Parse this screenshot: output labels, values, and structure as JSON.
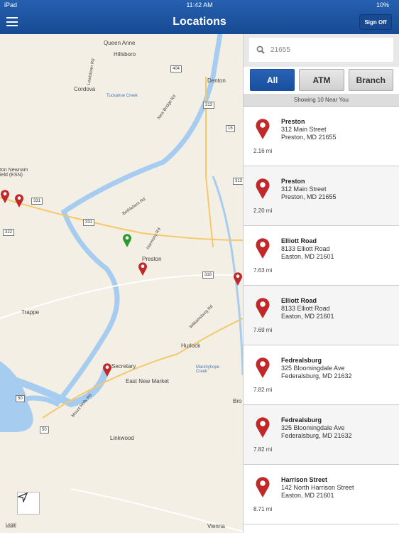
{
  "status": {
    "device": "iPad",
    "time": "11:42 AM",
    "battery": "10%"
  },
  "header": {
    "title": "Locations",
    "sign_off": "Sign Off"
  },
  "search": {
    "value": "21655"
  },
  "filters": [
    {
      "label": "All",
      "active": true
    },
    {
      "label": "ATM",
      "active": false
    },
    {
      "label": "Branch",
      "active": false
    }
  ],
  "showing": "Showing 10 Near You",
  "locations": [
    {
      "name": "Preston",
      "street": "312 Main Street",
      "city": "Preston, MD 21655",
      "distance": "2.16 mi"
    },
    {
      "name": "Preston",
      "street": "312 Main Street",
      "city": "Preston, MD 21655",
      "distance": "2.20 mi"
    },
    {
      "name": "Elliott Road",
      "street": "8133 Elliott Road",
      "city": "Easton, MD 21601",
      "distance": "7.63 mi"
    },
    {
      "name": "Elliott Road",
      "street": "8133 Elliott Road",
      "city": "Easton, MD 21601",
      "distance": "7.69 mi"
    },
    {
      "name": "Fedrealsburg",
      "street": "325 Bloomingdale Ave",
      "city": "Federalsburg, MD 21632",
      "distance": "7.82 mi"
    },
    {
      "name": "Fedrealsburg",
      "street": "325 Bloomingdale Ave",
      "city": "Federalsburg, MD 21632",
      "distance": "7.82 mi"
    },
    {
      "name": "Harrison Street",
      "street": "142 North Harrison Street",
      "city": "Easton, MD 21601",
      "distance": "8.71 mi"
    }
  ],
  "map": {
    "labels": {
      "queen_anne": "Queen Anne",
      "hillsboro": "Hillsboro",
      "cordova": "Cordova",
      "denton": "Denton",
      "tuckahoe": "Tuckahoe Creek",
      "lewistown": "Lewistown Rd",
      "new_bridge": "New Bridge Rd",
      "bethlehem": "Bethlehem Rd",
      "harmony": "Harmony Rd",
      "preston": "Preston",
      "trappe": "Trappe",
      "hurlock": "Hurlock",
      "williamsburg": "Williamsburg Rd",
      "secretary": "Secretary",
      "east_new_market": "East New Market",
      "marshyhope": "Marshyhope Creek",
      "mount_holly": "Mount Holly Rd",
      "linkwood": "Linkwood",
      "vienna": "Vienna",
      "airport": "ton Newnam ield (ESN)",
      "bro": "Bro",
      "legal": "Legal"
    },
    "shields": {
      "r404": "404",
      "r313a": "313",
      "r16": "16",
      "r313b": "313",
      "r331a": "331",
      "r331b": "331",
      "r322": "322",
      "r318": "318",
      "r50a": "50",
      "r50b": "50"
    }
  },
  "colors": {
    "header": "#1d55a3",
    "pin": "#c0282a",
    "user_pin": "#2e9a2e",
    "water": "#a6cdf0"
  }
}
